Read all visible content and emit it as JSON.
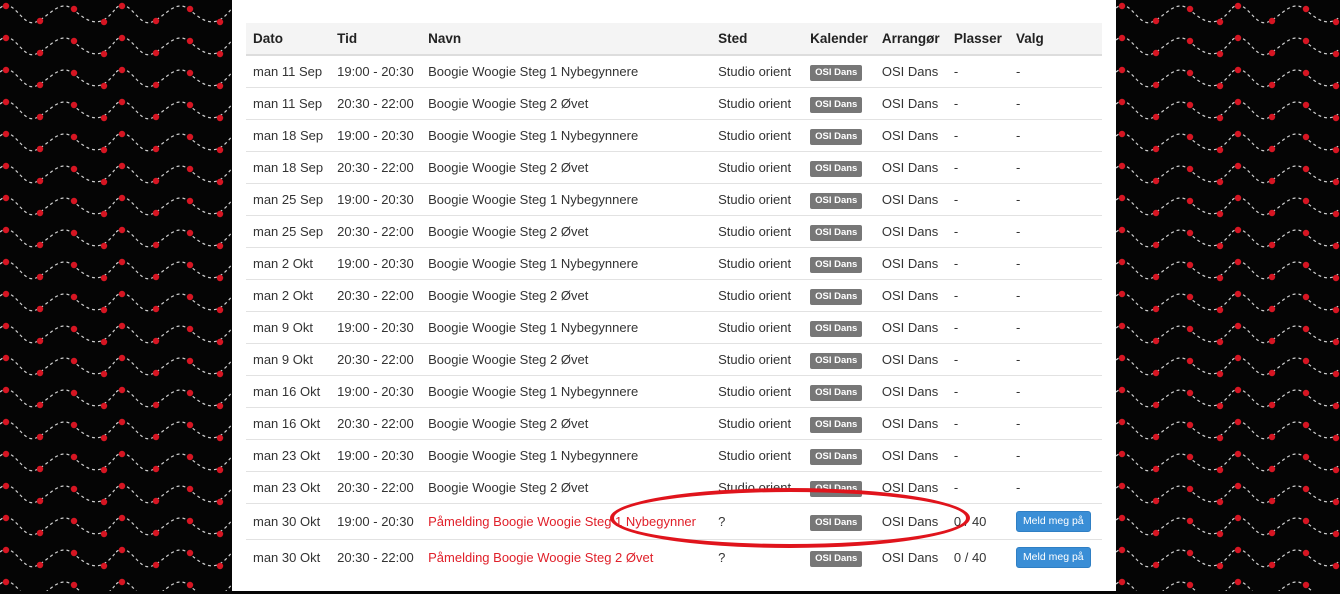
{
  "colors": {
    "accent_red": "#e0202a",
    "button_blue": "#3a8ed6",
    "label_grey": "#777777"
  },
  "table": {
    "headers": [
      "Dato",
      "Tid",
      "Navn",
      "Sted",
      "Kalender",
      "Arrangør",
      "Plasser",
      "Valg"
    ],
    "rows": [
      {
        "dato": "man 11 Sep",
        "tid": "19:00 - 20:30",
        "navn": "Boogie Woogie Steg 1 Nybegynnere",
        "sted": "Studio orient",
        "kalender": "OSI Dans",
        "arrangor": "OSI Dans",
        "plasser": "-",
        "valg": "-"
      },
      {
        "dato": "man 11 Sep",
        "tid": "20:30 - 22:00",
        "navn": "Boogie Woogie Steg 2 Øvet",
        "sted": "Studio orient",
        "kalender": "OSI Dans",
        "arrangor": "OSI Dans",
        "plasser": "-",
        "valg": "-"
      },
      {
        "dato": "man 18 Sep",
        "tid": "19:00 - 20:30",
        "navn": "Boogie Woogie Steg 1 Nybegynnere",
        "sted": "Studio orient",
        "kalender": "OSI Dans",
        "arrangor": "OSI Dans",
        "plasser": "-",
        "valg": "-"
      },
      {
        "dato": "man 18 Sep",
        "tid": "20:30 - 22:00",
        "navn": "Boogie Woogie Steg 2 Øvet",
        "sted": "Studio orient",
        "kalender": "OSI Dans",
        "arrangor": "OSI Dans",
        "plasser": "-",
        "valg": "-"
      },
      {
        "dato": "man 25 Sep",
        "tid": "19:00 - 20:30",
        "navn": "Boogie Woogie Steg 1 Nybegynnere",
        "sted": "Studio orient",
        "kalender": "OSI Dans",
        "arrangor": "OSI Dans",
        "plasser": "-",
        "valg": "-"
      },
      {
        "dato": "man 25 Sep",
        "tid": "20:30 - 22:00",
        "navn": "Boogie Woogie Steg 2 Øvet",
        "sted": "Studio orient",
        "kalender": "OSI Dans",
        "arrangor": "OSI Dans",
        "plasser": "-",
        "valg": "-"
      },
      {
        "dato": "man 2 Okt",
        "tid": "19:00 - 20:30",
        "navn": "Boogie Woogie Steg 1 Nybegynnere",
        "sted": "Studio orient",
        "kalender": "OSI Dans",
        "arrangor": "OSI Dans",
        "plasser": "-",
        "valg": "-"
      },
      {
        "dato": "man 2 Okt",
        "tid": "20:30 - 22:00",
        "navn": "Boogie Woogie Steg 2 Øvet",
        "sted": "Studio orient",
        "kalender": "OSI Dans",
        "arrangor": "OSI Dans",
        "plasser": "-",
        "valg": "-"
      },
      {
        "dato": "man 9 Okt",
        "tid": "19:00 - 20:30",
        "navn": "Boogie Woogie Steg 1 Nybegynnere",
        "sted": "Studio orient",
        "kalender": "OSI Dans",
        "arrangor": "OSI Dans",
        "plasser": "-",
        "valg": "-"
      },
      {
        "dato": "man 9 Okt",
        "tid": "20:30 - 22:00",
        "navn": "Boogie Woogie Steg 2 Øvet",
        "sted": "Studio orient",
        "kalender": "OSI Dans",
        "arrangor": "OSI Dans",
        "plasser": "-",
        "valg": "-"
      },
      {
        "dato": "man 16 Okt",
        "tid": "19:00 - 20:30",
        "navn": "Boogie Woogie Steg 1 Nybegynnere",
        "sted": "Studio orient",
        "kalender": "OSI Dans",
        "arrangor": "OSI Dans",
        "plasser": "-",
        "valg": "-"
      },
      {
        "dato": "man 16 Okt",
        "tid": "20:30 - 22:00",
        "navn": "Boogie Woogie Steg 2 Øvet",
        "sted": "Studio orient",
        "kalender": "OSI Dans",
        "arrangor": "OSI Dans",
        "plasser": "-",
        "valg": "-"
      },
      {
        "dato": "man 23 Okt",
        "tid": "19:00 - 20:30",
        "navn": "Boogie Woogie Steg 1 Nybegynnere",
        "sted": "Studio orient",
        "kalender": "OSI Dans",
        "arrangor": "OSI Dans",
        "plasser": "-",
        "valg": "-"
      },
      {
        "dato": "man 23 Okt",
        "tid": "20:30 - 22:00",
        "navn": "Boogie Woogie Steg 2 Øvet",
        "sted": "Studio orient",
        "kalender": "OSI Dans",
        "arrangor": "OSI Dans",
        "plasser": "-",
        "valg": "-"
      }
    ],
    "signup_rows": [
      {
        "dato": "man 30 Okt",
        "tid": "19:00 - 20:30",
        "navn": "Påmelding Boogie Woogie Steg 1 Nybegynner",
        "sted": "?",
        "kalender": "OSI Dans",
        "arrangor": "OSI Dans",
        "plasser": "0 / 40",
        "valg": "Meld meg på"
      },
      {
        "dato": "man 30 Okt",
        "tid": "20:30 - 22:00",
        "navn": "Påmelding Boogie Woogie Steg 2 Øvet",
        "sted": "?",
        "kalender": "OSI Dans",
        "arrangor": "OSI Dans",
        "plasser": "0 / 40",
        "valg": "Meld meg på"
      }
    ]
  }
}
